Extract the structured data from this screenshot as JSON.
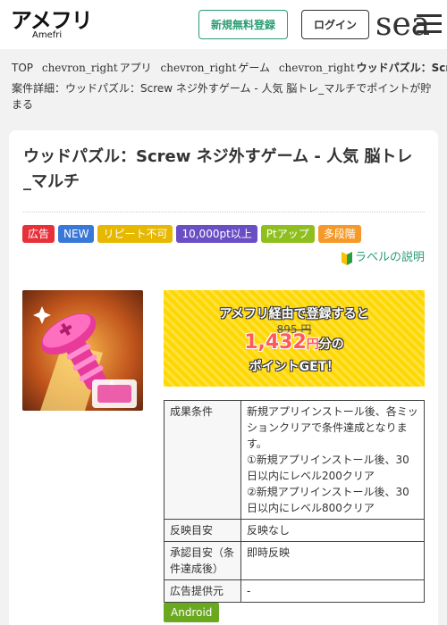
{
  "header": {
    "logo_main": "アメフリ",
    "logo_sub": "Amefri",
    "register_label": "新規無料登録",
    "login_label": "ログイン",
    "search_icon_text": "search",
    "menu_icon": "hamburger-menu-icon"
  },
  "breadcrumb": {
    "items": [
      "TOP",
      "アプリ",
      "ゲーム",
      "ウッドパズル：Screw ネジ外すゲーム - 人気 脳トレ_マルチ"
    ],
    "separator_text": "chevron_right"
  },
  "detail_line": "案件詳細：ウッドパズル：Screw ネジ外すゲーム - 人気 脳トレ_マルチでポイントが貯まる",
  "offer": {
    "title": "ウッドパズル：Screw ネジ外すゲーム - 人気 脳トレ_マルチ",
    "badges": [
      {
        "label": "広告",
        "color": "#e8303a"
      },
      {
        "label": "NEW",
        "color": "#3a78d8"
      },
      {
        "label": "リピート不可",
        "color": "#e6b800"
      },
      {
        "label": "10,000pt以上",
        "color": "#6a4fc4"
      },
      {
        "label": "Ptアップ",
        "color": "#8fbf1f"
      },
      {
        "label": "多段階",
        "color": "#f59a2a"
      }
    ],
    "label_help": "ラベルの説明",
    "promo": {
      "line1": "アメフリ経由で登録すると",
      "original": "895 円",
      "points": "1,432",
      "points_unit": "円",
      "points_suffix": "分の",
      "line3": "ポイントGET！"
    },
    "info_table": [
      {
        "key": "成果条件",
        "value": "新規アプリインストール後、各ミッションクリアで条件達成となります。\n①新規アプリインストール後、30日以内にレベル200クリア\n②新規アプリインストール後、30日以内にレベル800クリア"
      },
      {
        "key": "反映目安",
        "value": "反映なし"
      },
      {
        "key": "承認目安（条件達成後）",
        "value": "即時反映"
      },
      {
        "key": "広告提供元",
        "value": "-"
      }
    ],
    "os_badge": "Android"
  },
  "colors": {
    "brand_green": "#2a9d73",
    "promo_yellow": "#ffd700",
    "points_red": "#ff5a5a",
    "android_green": "#6aa81f"
  }
}
